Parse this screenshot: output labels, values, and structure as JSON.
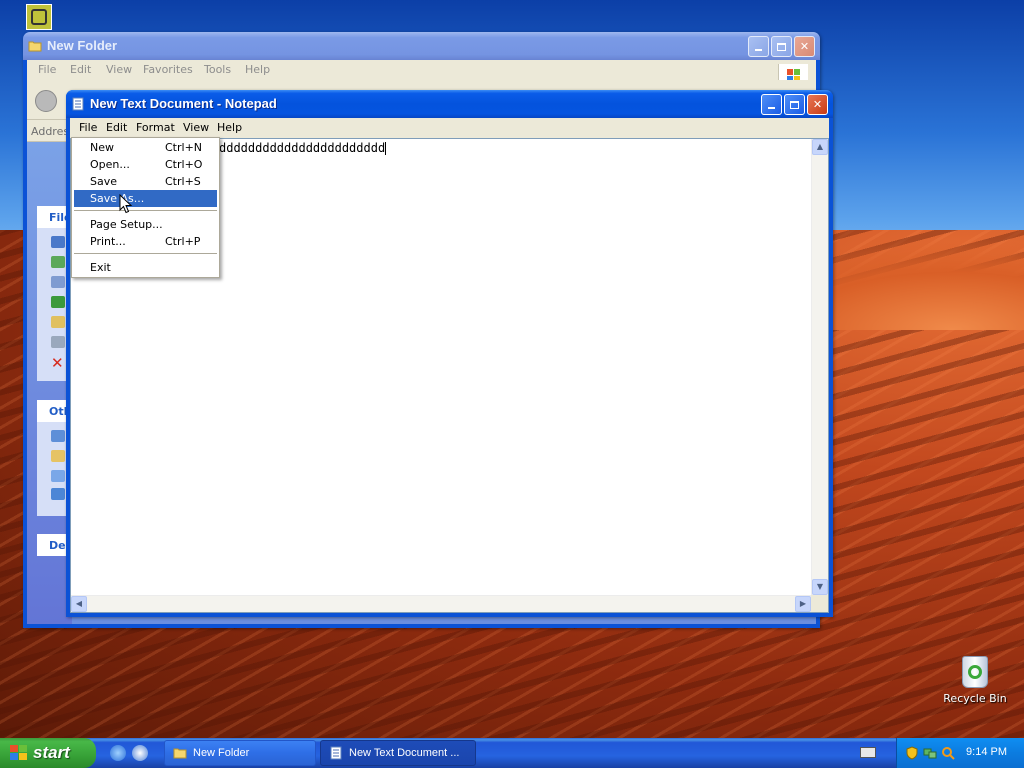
{
  "desktop": {
    "recycle_bin_label": "Recycle Bin"
  },
  "explorer": {
    "title": "New Folder",
    "menu": [
      "File",
      "Edit",
      "View",
      "Favorites",
      "Tools",
      "Help"
    ],
    "address_label": "Addres",
    "panels": [
      {
        "header": "File"
      },
      {
        "header": "Oth"
      },
      {
        "header": "De"
      }
    ]
  },
  "notepad": {
    "title": "New Text Document - Notepad",
    "menu": [
      "File",
      "Edit",
      "Format",
      "View",
      "Help"
    ],
    "content": "ddddddddddddddddddddddd"
  },
  "file_menu": {
    "items": [
      {
        "label": "New",
        "accel": "Ctrl+N"
      },
      {
        "label": "Open...",
        "accel": "Ctrl+O"
      },
      {
        "label": "Save",
        "accel": "Ctrl+S"
      },
      {
        "label": "Save As...",
        "accel": ""
      },
      {
        "label": "Page Setup...",
        "accel": ""
      },
      {
        "label": "Print...",
        "accel": "Ctrl+P"
      },
      {
        "label": "Exit",
        "accel": ""
      }
    ],
    "hovered": "Save As..."
  },
  "taskbar": {
    "start_label": "start",
    "tasks": [
      {
        "label": "New Folder"
      },
      {
        "label": "New Text Document ..."
      }
    ],
    "clock": "9:14 PM"
  },
  "colors": {
    "titlebar_active": "#0554e0",
    "menu_highlight": "#316ac5",
    "start_green": "#37a137",
    "taskbar_blue": "#2663e0"
  },
  "icons": [
    "notepad-icon",
    "folder-icon",
    "windows-flag-icon",
    "recycle-bin-icon",
    "ie-icon",
    "security-shield-icon",
    "keyboard-icon"
  ]
}
